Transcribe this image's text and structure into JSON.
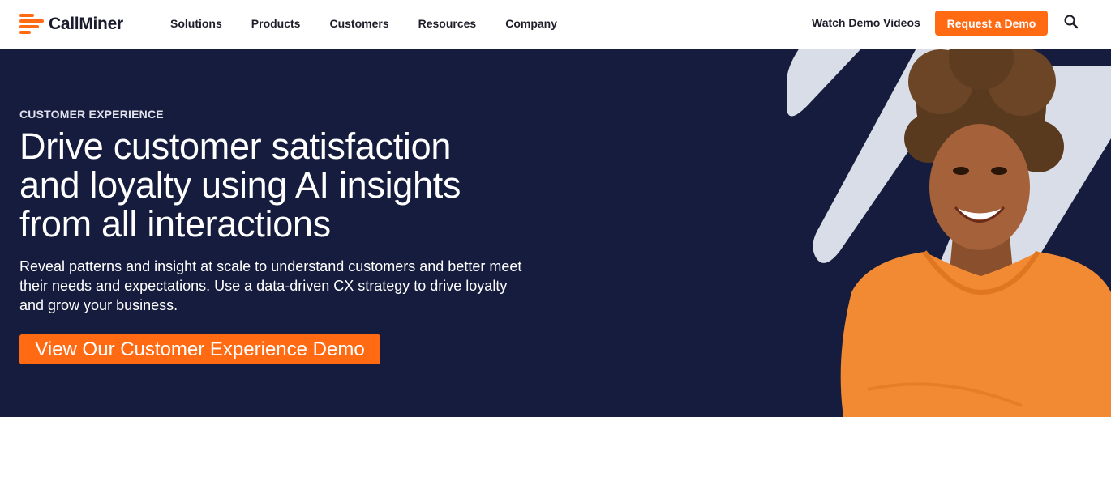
{
  "brand": {
    "name": "CallMiner",
    "accent": "#ff6a13",
    "navy": "#161c3d"
  },
  "nav": {
    "items": [
      {
        "label": "Solutions"
      },
      {
        "label": "Products"
      },
      {
        "label": "Customers"
      },
      {
        "label": "Resources"
      },
      {
        "label": "Company"
      }
    ],
    "watch_label": "Watch Demo Videos",
    "request_label": "Request a Demo",
    "search_icon": "search-icon"
  },
  "hero": {
    "eyebrow": "CUSTOMER EXPERIENCE",
    "headline_lines": [
      "Drive customer satisfaction",
      "and loyalty using AI insights",
      "from all interactions"
    ],
    "subtext": "Reveal patterns and insight at scale to understand customers and better meet their needs and expectations. Use a data-driven CX strategy to drive loyalty and grow your business.",
    "cta_label": "View Our Customer Experience Demo"
  }
}
